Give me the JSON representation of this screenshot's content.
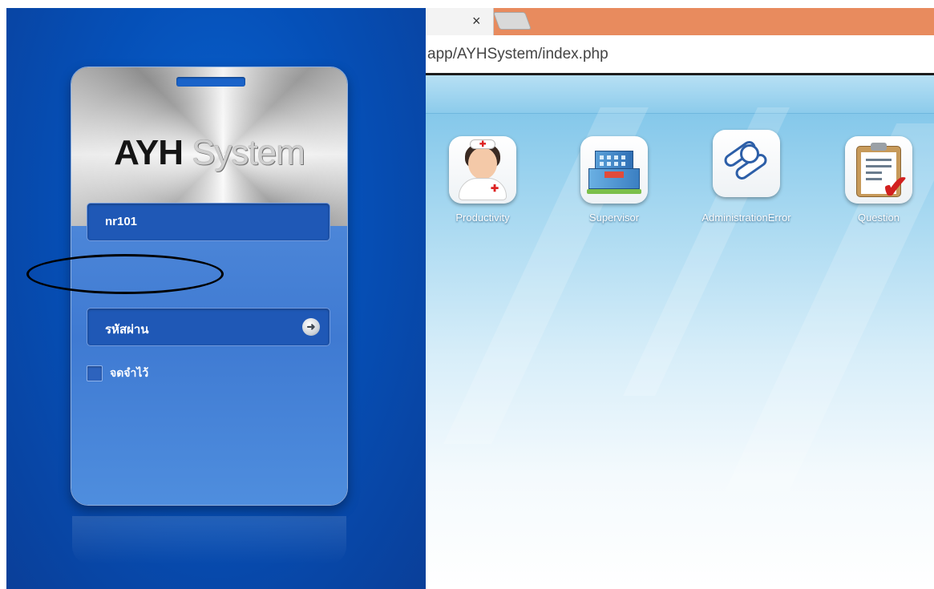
{
  "login": {
    "logo_bold": "AYH",
    "logo_light": " System",
    "username_value": "nr101",
    "password_placeholder": "รหัสผ่าน",
    "go_icon": "arrow-right-circle-icon",
    "remember_label": "จดจำไว้"
  },
  "browser": {
    "tab_close": "×",
    "address": "app/AYHSystem/index.php"
  },
  "apps": [
    {
      "label": "Productivity",
      "icon": "nurse-icon"
    },
    {
      "label": "Supervisor",
      "icon": "hospital-building-icon"
    },
    {
      "label": "AdministrationError",
      "icon": "pills-icon"
    },
    {
      "label": "Question",
      "icon": "clipboard-check-icon"
    }
  ],
  "colors": {
    "left_background": "#0550b8",
    "tab_strip": "#e88b5e",
    "annotation": "#000000"
  }
}
